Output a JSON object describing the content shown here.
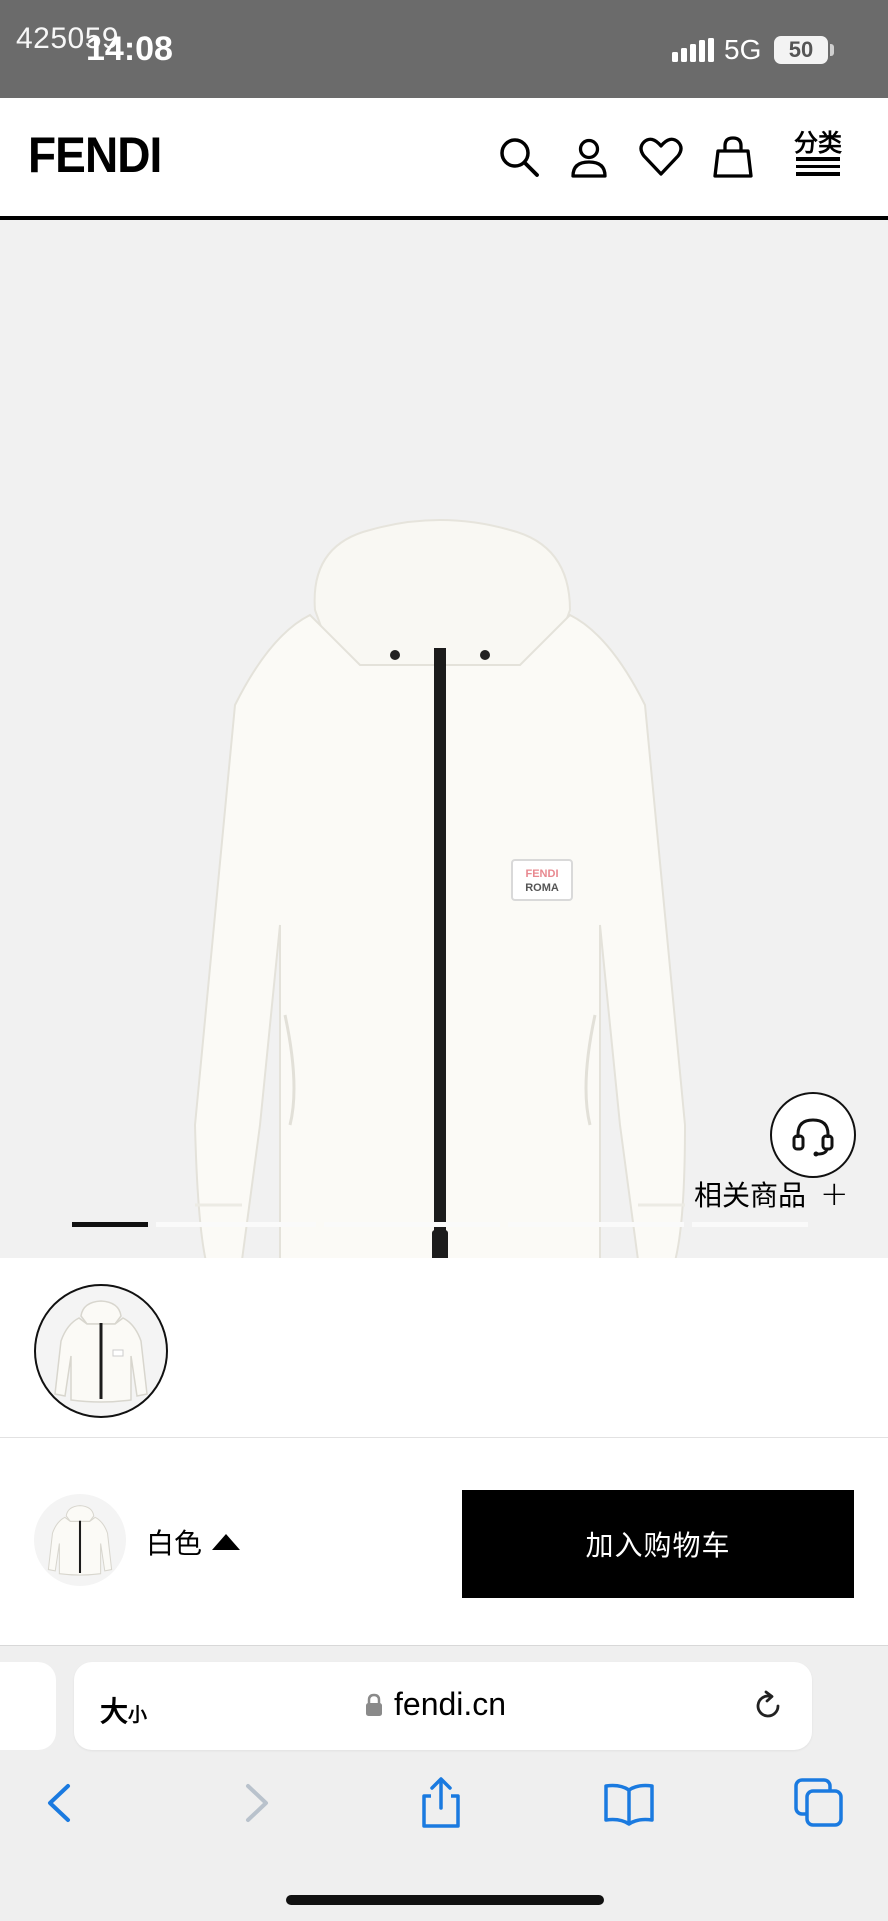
{
  "status_bar": {
    "watermark": "425059",
    "time": "14:08",
    "network": "5G",
    "battery": "50"
  },
  "header": {
    "logo": "FENDI",
    "icons": [
      "search-icon",
      "account-icon",
      "heart-icon",
      "bag-icon"
    ],
    "menu_label": "分类"
  },
  "product": {
    "related_label": "相关商品",
    "related_plus": "+",
    "carousel": {
      "total": 5,
      "active": 0
    },
    "patch_top": "FENDI",
    "patch_bottom": "ROMA"
  },
  "action_bar": {
    "color_label": "白色",
    "add_to_cart": "加入购物车"
  },
  "browser": {
    "text_size_big": "大",
    "text_size_small": "小",
    "url": "fendi.cn"
  },
  "colors": {
    "status_bar_bg": "#6b6b6b",
    "stage_bg": "#f1f1f1",
    "cart_button_bg": "#000000",
    "accent_blue": "#1a7ae0",
    "patch_pink": "#e8888f"
  }
}
